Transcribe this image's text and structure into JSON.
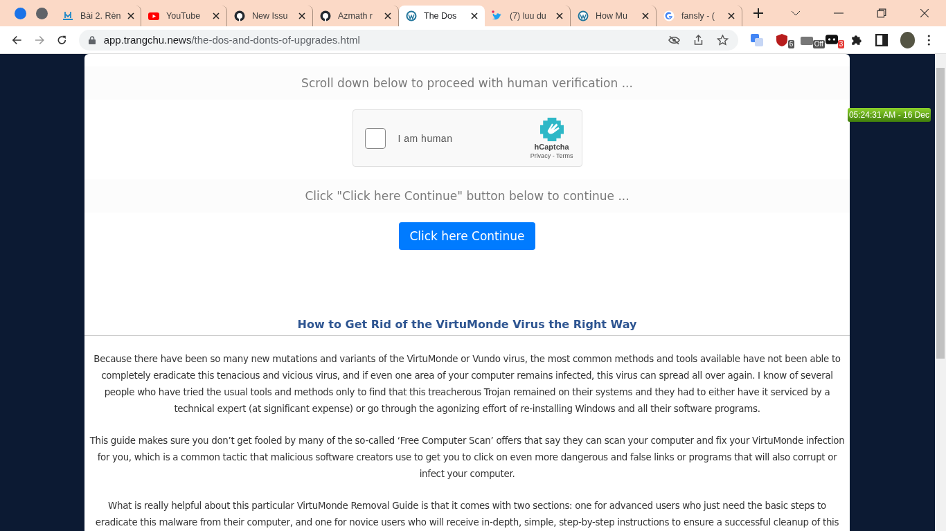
{
  "browser": {
    "tab_groups": [
      {
        "color": "#1a73e8"
      },
      {
        "color": "#5f6368"
      }
    ],
    "tabs": [
      {
        "title": "Bài 2. Rèn",
        "kind": "sign",
        "selected": false
      },
      {
        "title": "YouTube",
        "kind": "youtube",
        "selected": false
      },
      {
        "title": "New Issu",
        "kind": "github",
        "selected": false
      },
      {
        "title": "Azmath r",
        "kind": "github",
        "selected": false
      },
      {
        "title": "The Dos",
        "kind": "wordpress",
        "selected": true
      },
      {
        "title": "(7) luu du",
        "kind": "twitter",
        "selected": false
      },
      {
        "title": "How Mu",
        "kind": "wordpress",
        "selected": false
      },
      {
        "title": "fansly - (",
        "kind": "google",
        "selected": false
      }
    ],
    "address": {
      "domain": "app.trangchu.news",
      "path": "/the-dos-and-donts-of-upgrades.html"
    },
    "extensions": [
      {
        "kind": "translate"
      },
      {
        "kind": "shield",
        "badge": "6"
      },
      {
        "kind": "camera",
        "badge": "Off"
      },
      {
        "kind": "chat",
        "badge": "3"
      },
      {
        "kind": "puzzle"
      },
      {
        "kind": "sidepanel"
      }
    ]
  },
  "clock": "05:24:31 AM - 16 Dec",
  "page": {
    "scroll_note": "Scroll down below to proceed with human verification ...",
    "captcha": {
      "label": "I am human",
      "checked": false,
      "brand": "hCaptcha",
      "privacy": "Privacy",
      "separator": "-",
      "terms": "Terms"
    },
    "continue_note": "Click \"Click here Continue\" button below to continue ...",
    "continue_button": "Click here Continue",
    "heading": "How to Get Rid of the VirtuMonde Virus the Right Way",
    "paragraphs": [
      "Because there have been so many new mutations and variants of the VirtuMonde or Vundo virus, the most common methods and tools available have not been able to completely eradicate this tenacious and vicious virus, and if even one area of your computer remains infected, this virus can spread all over again. I know of several people who have tried the usual tools and methods only to find that this treacherous Trojan remained on their systems and they had to either have it serviced by a technical expert (at significant expense) or go through the agonizing effort of re-installing Windows and all their software programs.",
      "This guide makes sure you don’t get fooled by many of the so-called ‘Free Computer Scan’ offers that say they can scan your computer and fix your VirtuMonde infection for you, which is a common tactic that malicious software creators use to get you to click on even more dangerous and false links or programs that will also corrupt or infect your computer.",
      "What is really helpful about this particular VirtuMonde Removal Guide is that it comes with two sections: one for advanced users who just need the basic steps to eradicate this malware from their computer, and one for novice users who will receive in-depth, simple, step-by-step instructions to ensure a successful cleanup of this"
    ]
  }
}
